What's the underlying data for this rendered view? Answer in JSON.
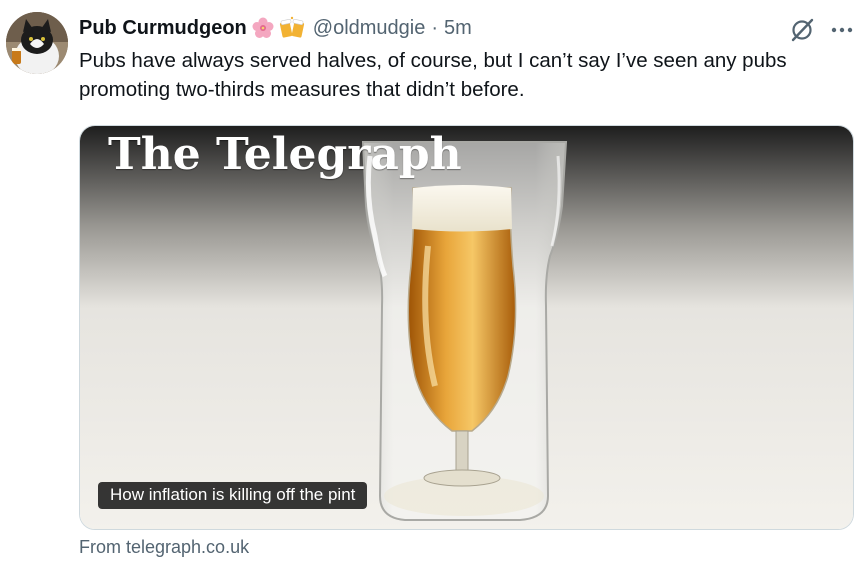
{
  "author": {
    "display_name": "Pub Curmudgeon",
    "badges": [
      "cherry-blossom-icon",
      "beer-mugs-icon"
    ],
    "handle": "@oldmudgie",
    "separator": "·",
    "time": "5m"
  },
  "tweet": {
    "text": "Pubs have always served halves, of course, but I can’t say I’ve seen any pubs promoting two-thirds measures that didn’t before."
  },
  "card": {
    "masthead": "The Telegraph",
    "caption": "How inflation is killing off the pint",
    "source": "From telegraph.co.uk"
  },
  "colors": {
    "secondary_text": "#536471",
    "primary_text": "#0f1419",
    "border": "#cfd9de",
    "beer": "#d98a14"
  }
}
